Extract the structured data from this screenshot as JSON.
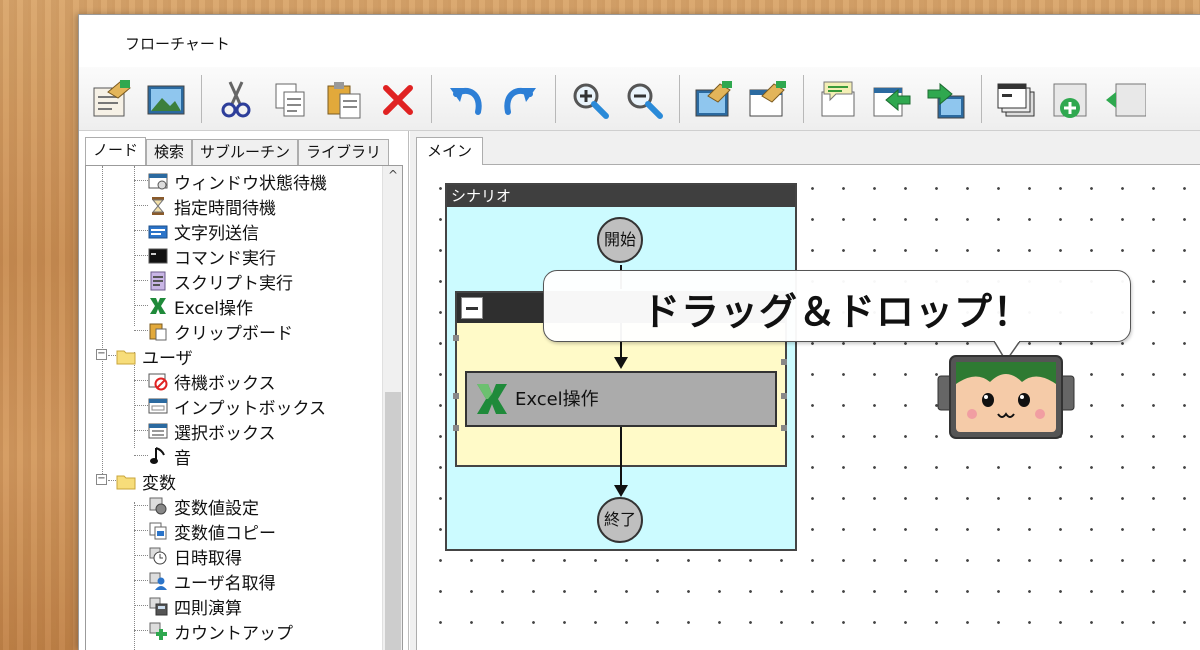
{
  "window": {
    "title": "フローチャート"
  },
  "toolbar": {
    "buttons": [
      {
        "icon": "new-flow-icon"
      },
      {
        "icon": "image-icon"
      },
      {
        "icon": "cut-icon"
      },
      {
        "icon": "copy-icon"
      },
      {
        "icon": "paste-icon"
      },
      {
        "icon": "delete-icon"
      },
      {
        "icon": "undo-icon"
      },
      {
        "icon": "redo-icon"
      },
      {
        "icon": "zoom-in-icon"
      },
      {
        "icon": "zoom-out-icon"
      },
      {
        "icon": "edit-node-icon"
      },
      {
        "icon": "edit-window-icon"
      },
      {
        "icon": "comment-icon"
      },
      {
        "icon": "import-icon"
      },
      {
        "icon": "export-icon"
      },
      {
        "icon": "windows-icon"
      },
      {
        "icon": "add-icon"
      },
      {
        "icon": "nav-icon"
      }
    ]
  },
  "left_tabs": [
    "ノード",
    "検索",
    "サブルーチン",
    "ライブラリ"
  ],
  "tree": {
    "items": [
      {
        "label": "ウィンドウ状態待機",
        "icon": "window-wait-icon"
      },
      {
        "label": "指定時間待機",
        "icon": "hourglass-icon"
      },
      {
        "label": "文字列送信",
        "icon": "keyboard-icon"
      },
      {
        "label": "コマンド実行",
        "icon": "terminal-icon"
      },
      {
        "label": "スクリプト実行",
        "icon": "script-icon"
      },
      {
        "label": "Excel操作",
        "icon": "excel-icon"
      },
      {
        "label": "クリップボード",
        "icon": "clipboard-icon"
      },
      {
        "label": "ユーザ",
        "icon": "folder-icon"
      },
      {
        "label": "待機ボックス",
        "icon": "wait-box-icon"
      },
      {
        "label": "インプットボックス",
        "icon": "input-box-icon"
      },
      {
        "label": "選択ボックス",
        "icon": "select-box-icon"
      },
      {
        "label": "音",
        "icon": "music-note-icon"
      },
      {
        "label": "変数",
        "icon": "folder-icon"
      },
      {
        "label": "変数値設定",
        "icon": "variable-set-icon"
      },
      {
        "label": "変数値コピー",
        "icon": "variable-copy-icon"
      },
      {
        "label": "日時取得",
        "icon": "clock-icon"
      },
      {
        "label": "ユーザ名取得",
        "icon": "user-icon"
      },
      {
        "label": "四則演算",
        "icon": "calculator-icon"
      },
      {
        "label": "カウントアップ",
        "icon": "count-up-icon"
      }
    ]
  },
  "main_tab": "メイン",
  "scenario": {
    "title": "シナリオ",
    "start": "開始",
    "end": "終了",
    "action": {
      "label": "Excel操作",
      "icon": "excel-icon"
    }
  },
  "callout": {
    "text": "ドラッグ＆ドロップ！"
  },
  "colors": {
    "scenario_bg": "#ccfbff",
    "group_bg": "#fffac8",
    "excel_green": "#1f8a3a"
  }
}
